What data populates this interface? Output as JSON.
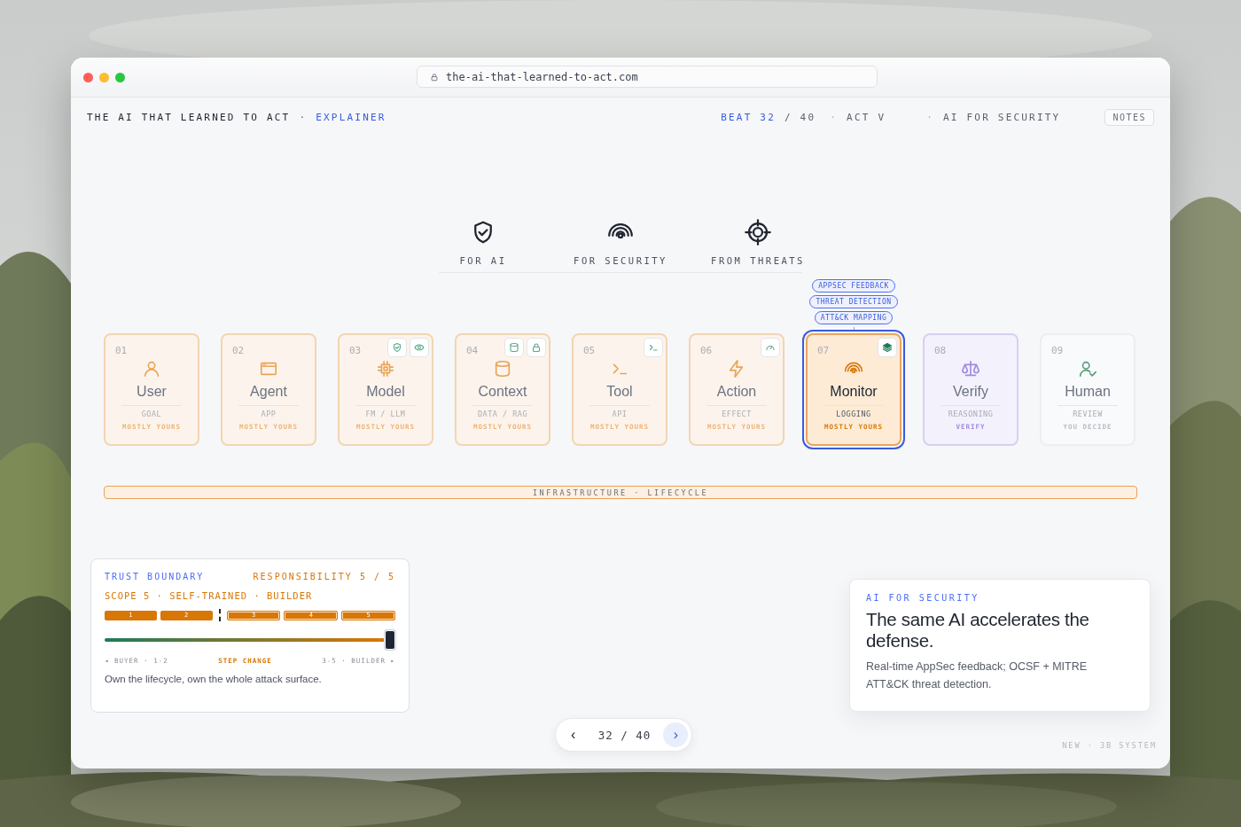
{
  "window": {
    "address": "the-ai-that-learned-to-act.com"
  },
  "header": {
    "title": "THE AI THAT LEARNED TO ACT",
    "separator": "·",
    "section": "EXPLAINER",
    "beat": "BEAT 32",
    "beat_total": "/ 40",
    "items": [
      {
        "separator": "·",
        "text": "ACT V"
      },
      {
        "separator": "·",
        "text": "AI FOR SECURITY"
      }
    ],
    "notes_button": "NOTES"
  },
  "pillars": [
    {
      "label": "FOR AI"
    },
    {
      "label": "FOR SECURITY"
    },
    {
      "label": "FROM THREATS"
    }
  ],
  "stages": [
    {
      "number": "01",
      "name": "User",
      "detail": "GOAL",
      "owner": "MOSTLY YOURS",
      "kind": "yours",
      "selected": false
    },
    {
      "number": "02",
      "name": "Agent",
      "detail": "APP",
      "owner": "MOSTLY YOURS",
      "kind": "yours",
      "selected": false
    },
    {
      "number": "03",
      "name": "Model",
      "detail": "FM / LLM",
      "owner": "MOSTLY YOURS",
      "kind": "yours",
      "selected": false
    },
    {
      "number": "04",
      "name": "Context",
      "detail": "DATA / RAG",
      "owner": "MOSTLY YOURS",
      "kind": "yours",
      "selected": false
    },
    {
      "number": "05",
      "name": "Tool",
      "detail": "API",
      "owner": "MOSTLY YOURS",
      "kind": "yours",
      "selected": false
    },
    {
      "number": "06",
      "name": "Action",
      "detail": "EFFECT",
      "owner": "MOSTLY YOURS",
      "kind": "yours",
      "selected": false
    },
    {
      "number": "07",
      "name": "Monitor",
      "detail": "LOGGING",
      "owner": "MOSTLY YOURS",
      "kind": "yours",
      "selected": true,
      "tags": [
        "APPSEC FEEDBACK",
        "THREAT DETECTION",
        "ATT&CK MAPPING"
      ]
    },
    {
      "number": "08",
      "name": "Verify",
      "detail": "REASONING",
      "owner": "VERIFY",
      "kind": "verify",
      "selected": false
    },
    {
      "number": "09",
      "name": "Human",
      "detail": "REVIEW",
      "owner": "YOU DECIDE",
      "kind": "decide",
      "selected": false
    }
  ],
  "infrastructure_bar": "INFRASTRUCTURE · LIFECYCLE",
  "trust_panel": {
    "title": "TRUST BOUNDARY",
    "responsibility": "RESPONSIBILITY 5 / 5",
    "scope": "SCOPE 5 · SELF-TRAINED · BUILDER",
    "segments": [
      {
        "label": "1",
        "kind": "buyer"
      },
      {
        "label": "2",
        "kind": "buyer"
      },
      {
        "label": "3",
        "kind": "builder"
      },
      {
        "label": "4",
        "kind": "builder"
      },
      {
        "label": "5",
        "kind": "builder"
      }
    ],
    "slider": {
      "level": 1
    },
    "left_label": "◂ BUYER · 1-2",
    "center_label": "STEP CHANGE",
    "right_label": "3-5 · BUILDER ▸",
    "summary": "Own the lifecycle, own the whole attack surface."
  },
  "callout": {
    "eyebrow": "AI FOR SECURITY",
    "headline": "The same AI accelerates the defense.",
    "body": "Real-time AppSec feedback; OCSF + MITRE ATT&CK threat detection."
  },
  "pager": {
    "prev": "‹",
    "position": "32 / 40",
    "next": "›"
  },
  "footer": "NEW · 3B SYSTEM"
}
